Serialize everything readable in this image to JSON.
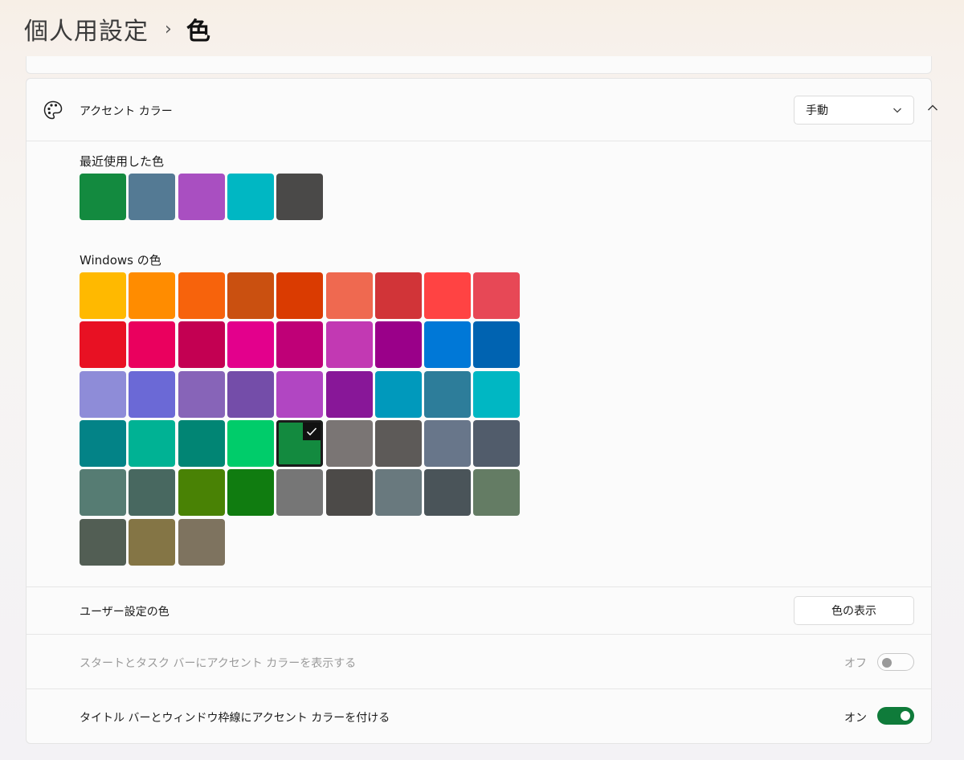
{
  "header": {
    "parent": "個人用設定",
    "separator": "›",
    "current": "色"
  },
  "accent": {
    "label": "アクセント カラー",
    "mode": "手動",
    "expanded": true
  },
  "recent": {
    "label": "最近使用した色",
    "colors": [
      "#138a3f",
      "#547a94",
      "#a94fc1",
      "#00b7c3",
      "#4a4948"
    ]
  },
  "windows_colors": {
    "label": "Windows の色",
    "selected_index": 31,
    "colors": [
      "#ffb900",
      "#ff8c00",
      "#f7630c",
      "#ca5010",
      "#da3b01",
      "#ef6950",
      "#d13438",
      "#ff4343",
      "#e74856",
      "#e81123",
      "#ea005e",
      "#c30052",
      "#e3008c",
      "#bf0077",
      "#c239b3",
      "#9a0089",
      "#0078d7",
      "#0063b1",
      "#8e8cd8",
      "#6b69d6",
      "#8764b8",
      "#744da9",
      "#b146c2",
      "#881798",
      "#0099bc",
      "#2d7d9a",
      "#00b7c3",
      "#038387",
      "#00b294",
      "#018574",
      "#00cc6a",
      "#138a3f",
      "#7a7574",
      "#5d5a58",
      "#68768a",
      "#515c6b",
      "#567c73",
      "#486860",
      "#498205",
      "#107c10",
      "#767676",
      "#4c4a48",
      "#69797e",
      "#4a5459",
      "#647c64",
      "#525e54",
      "#847545",
      "#7e735f"
    ]
  },
  "custom_color": {
    "label": "ユーザー設定の色",
    "button": "色の表示"
  },
  "start_taskbar": {
    "label": "スタートとタスク バーにアクセント カラーを表示する",
    "state_text": "オフ",
    "on": false,
    "disabled": true
  },
  "title_bars": {
    "label": "タイトル バーとウィンドウ枠線にアクセント カラーを付ける",
    "state_text": "オン",
    "on": true,
    "accent": "#0f7b3a"
  }
}
